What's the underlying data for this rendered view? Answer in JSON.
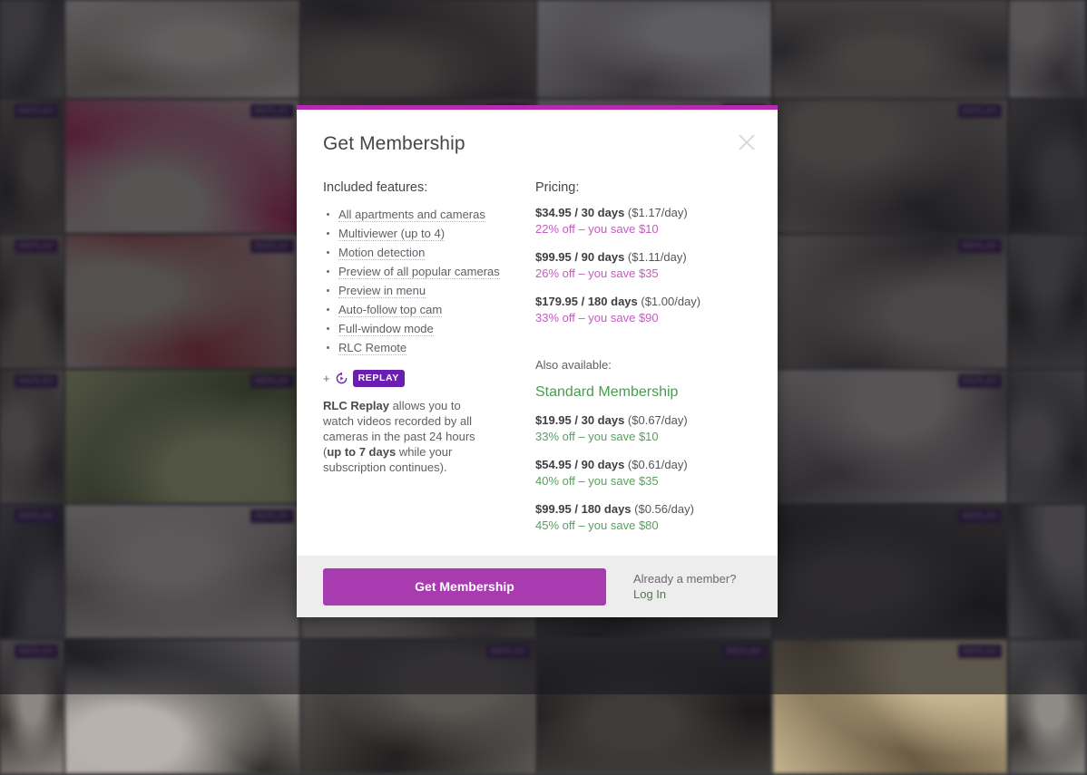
{
  "modal": {
    "title": "Get Membership",
    "close_icon": "close-icon",
    "accent_color": "#b52ab0",
    "features": {
      "heading": "Included features:",
      "items": [
        "All apartments and cameras",
        "Multiviewer (up to 4)",
        "Motion detection",
        "Preview of all popular cameras",
        "Preview in menu",
        "Auto-follow top cam",
        "Full-window mode",
        "RLC Remote"
      ],
      "replay_plus": "+",
      "replay_icon": "replay-circular-arrow-icon",
      "replay_badge": "REPLAY",
      "replay_desc_prefix_bold": "RLC Replay",
      "replay_desc_mid": " allows you to watch videos recorded by all cameras in the past 24 hours (",
      "replay_desc_bold2": "up to 7 days",
      "replay_desc_suffix": " while your subscription continues)."
    },
    "pricing": {
      "heading": "Pricing:",
      "accent_color": "#c45cc0",
      "plans": [
        {
          "price_bold": "$34.95 / 30 days",
          "per_day": " ($1.17/day)",
          "save": "22% off – you save $10"
        },
        {
          "price_bold": "$99.95 / 90 days",
          "per_day": " ($1.11/day)",
          "save": "26% off – you save $35"
        },
        {
          "price_bold": "$179.95 / 180 days",
          "per_day": " ($1.00/day)",
          "save": "33% off – you save $90"
        }
      ]
    },
    "standard": {
      "also_available": "Also available:",
      "title": "Standard Membership",
      "accent_color": "#4a9b52",
      "plans": [
        {
          "price_bold": "$19.95 / 30 days",
          "per_day": " ($0.67/day)",
          "save": "33% off – you save $10"
        },
        {
          "price_bold": "$54.95 / 90 days",
          "per_day": " ($0.61/day)",
          "save": "40% off – you save $35"
        },
        {
          "price_bold": "$99.95 / 180 days",
          "per_day": " ($0.56/day)",
          "save": "45% off – you save $80"
        }
      ]
    },
    "footer": {
      "cta_label": "Get Membership",
      "cta_color": "#a93bb0",
      "already_member": "Already a member?",
      "login_label": "Log In"
    }
  },
  "background": {
    "replay_badge_label": "REPLAY",
    "cells": [
      {
        "r": 1,
        "c": 1,
        "badge": false,
        "tone": "#6e6a66",
        "tone2": "#3c3a3a"
      },
      {
        "r": 1,
        "c": 2,
        "badge": false,
        "tone": "#cfc7bf",
        "tone2": "#8e8277"
      },
      {
        "r": 1,
        "c": 3,
        "badge": false,
        "tone": "#7a7065",
        "tone2": "#2e2b2a"
      },
      {
        "r": 1,
        "c": 4,
        "badge": false,
        "tone": "#c9c5c2",
        "tone2": "#6e6864"
      },
      {
        "r": 1,
        "c": 5,
        "badge": false,
        "tone": "#8e8378",
        "tone2": "#43403e"
      },
      {
        "r": 1,
        "c": 6,
        "badge": false,
        "tone": "#b4aea8",
        "tone2": "#585350"
      },
      {
        "r": 2,
        "c": 1,
        "badge": true,
        "tone": "#6a6058",
        "tone2": "#2b2826"
      },
      {
        "r": 2,
        "c": 2,
        "badge": true,
        "tone": "#b7aea6",
        "tone2": "#b02a5a"
      },
      {
        "r": 2,
        "c": 3,
        "badge": true,
        "tone": "#8d8277",
        "tone2": "#3a3634"
      },
      {
        "r": 2,
        "c": 4,
        "badge": true,
        "tone": "#c6c0ba",
        "tone2": "#7a6f66"
      },
      {
        "r": 2,
        "c": 5,
        "badge": true,
        "tone": "#8a8076",
        "tone2": "#312e2c"
      },
      {
        "r": 2,
        "c": 6,
        "badge": false,
        "tone": "#5e5a56",
        "tone2": "#262422"
      },
      {
        "r": 3,
        "c": 1,
        "badge": true,
        "tone": "#7d746a",
        "tone2": "#332f2c"
      },
      {
        "r": 3,
        "c": 2,
        "badge": true,
        "tone": "#b0a69c",
        "tone2": "#9c2f3a"
      },
      {
        "r": 3,
        "c": 3,
        "badge": true,
        "tone": "#6f6760",
        "tone2": "#2a2725"
      },
      {
        "r": 3,
        "c": 4,
        "badge": true,
        "tone": "#bdb7b1",
        "tone2": "#6b645e"
      },
      {
        "r": 3,
        "c": 5,
        "badge": true,
        "tone": "#9a9088",
        "tone2": "#403c39"
      },
      {
        "r": 3,
        "c": 6,
        "badge": false,
        "tone": "#6a6662",
        "tone2": "#2c2a28"
      },
      {
        "r": 4,
        "c": 1,
        "badge": true,
        "tone": "#8a8078",
        "tone2": "#3a3633"
      },
      {
        "r": 4,
        "c": 2,
        "badge": true,
        "tone": "#a8b07a",
        "tone2": "#4e5a32"
      },
      {
        "r": 4,
        "c": 3,
        "badge": true,
        "tone": "#c4beb8",
        "tone2": "#7b736c"
      },
      {
        "r": 4,
        "c": 4,
        "badge": true,
        "tone": "#cac4be",
        "tone2": "#8a827a"
      },
      {
        "r": 4,
        "c": 5,
        "badge": true,
        "tone": "#b6b0aa",
        "tone2": "#5a5552"
      },
      {
        "r": 4,
        "c": 6,
        "badge": false,
        "tone": "#7a7672",
        "tone2": "#302e2c"
      },
      {
        "r": 5,
        "c": 1,
        "badge": true,
        "tone": "#5c5a60",
        "tone2": "#24232a"
      },
      {
        "r": 5,
        "c": 2,
        "badge": true,
        "tone": "#c2bcb6",
        "tone2": "#8a7f76"
      },
      {
        "r": 5,
        "c": 3,
        "badge": true,
        "tone": "#9e968e",
        "tone2": "#44403c"
      },
      {
        "r": 5,
        "c": 4,
        "badge": true,
        "tone": "#6e6a66",
        "tone2": "#2a2826"
      },
      {
        "r": 5,
        "c": 5,
        "badge": true,
        "tone": "#4e4a46",
        "tone2": "#1e1c1a"
      },
      {
        "r": 5,
        "c": 6,
        "badge": false,
        "tone": "#8a8682",
        "tone2": "#3a3836"
      },
      {
        "r": 6,
        "c": 1,
        "badge": true,
        "tone": "#8e8680",
        "tone2": "#3c3836"
      },
      {
        "r": 6,
        "c": 2,
        "badge": false,
        "tone": "#b8b2ac",
        "tone2": "#2e2c2a"
      },
      {
        "r": 6,
        "c": 3,
        "badge": true,
        "tone": "#5a5652",
        "tone2": "#222020"
      },
      {
        "r": 6,
        "c": 4,
        "badge": true,
        "tone": "#3e3c3a",
        "tone2": "#1a1818"
      },
      {
        "r": 6,
        "c": 5,
        "badge": true,
        "tone": "#c6b48e",
        "tone2": "#6a5c44"
      },
      {
        "r": 6,
        "c": 6,
        "badge": false,
        "tone": "#8e8a86",
        "tone2": "#3a3836"
      }
    ]
  }
}
